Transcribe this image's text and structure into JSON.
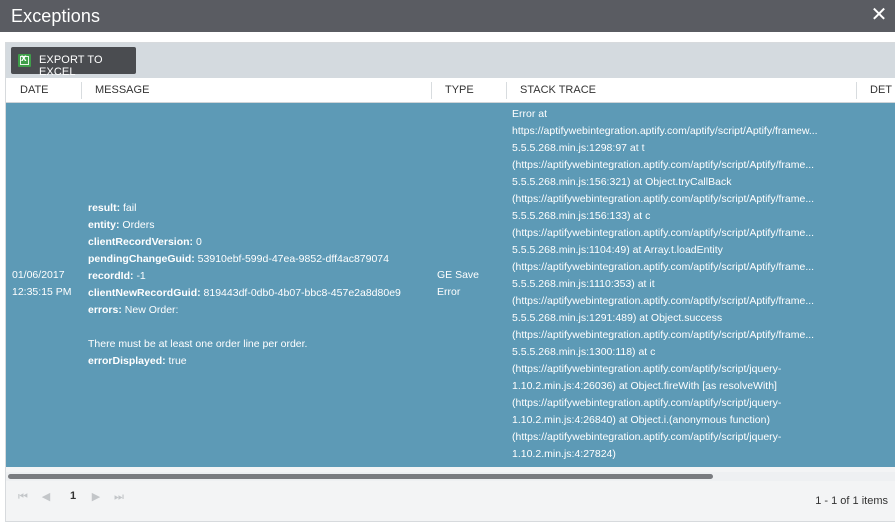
{
  "window": {
    "title": "Exceptions"
  },
  "toolbar": {
    "export_label": "EXPORT TO EXCEL"
  },
  "columns": {
    "date": "DATE",
    "message": "MESSAGE",
    "type": "TYPE",
    "stack": "STACK TRACE",
    "details": "DET"
  },
  "row": {
    "date": [
      "01/06/2017",
      "12:35:15 PM"
    ],
    "message": [
      {
        "k": "result:",
        "v": "fail"
      },
      {
        "k": "entity:",
        "v": "Orders"
      },
      {
        "k": "clientRecordVersion:",
        "v": "0"
      },
      {
        "k": "pendingChangeGuid:",
        "v": "53910ebf-599d-47ea-9852-dff4ac879074"
      },
      {
        "k": "recordId:",
        "v": "-1"
      },
      {
        "k": "clientNewRecordGuid:",
        "v": "819443df-0db0-4b07-bbc8-457e2a8d80e9"
      },
      {
        "k": "errors:",
        "v": "New Order:"
      },
      {
        "k": "",
        "v": ""
      },
      {
        "k": "",
        "v": "There must be at least one order line per order."
      },
      {
        "k": "errorDisplayed:",
        "v": "true"
      }
    ],
    "type": [
      "GE Save",
      "Error"
    ],
    "stack": [
      "Error at",
      "https://aptifywebintegration.aptify.com/aptify/script/Aptify/framew...",
      "5.5.5.268.min.js:1298:97 at t",
      "(https://aptifywebintegration.aptify.com/aptify/script/Aptify/frame...",
      "5.5.5.268.min.js:156:321) at Object.tryCallBack",
      "(https://aptifywebintegration.aptify.com/aptify/script/Aptify/frame...",
      "5.5.5.268.min.js:156:133) at c",
      "(https://aptifywebintegration.aptify.com/aptify/script/Aptify/frame...",
      "5.5.5.268.min.js:1104:49) at Array.t.loadEntity",
      "(https://aptifywebintegration.aptify.com/aptify/script/Aptify/frame...",
      "5.5.5.268.min.js:1110:353) at it",
      "(https://aptifywebintegration.aptify.com/aptify/script/Aptify/frame...",
      "5.5.5.268.min.js:1291:489) at Object.success",
      "(https://aptifywebintegration.aptify.com/aptify/script/Aptify/frame...",
      "5.5.5.268.min.js:1300:118) at c",
      "(https://aptifywebintegration.aptify.com/aptify/script/jquery-",
      "1.10.2.min.js:4:26036) at Object.fireWith [as resolveWith]",
      "(https://aptifywebintegration.aptify.com/aptify/script/jquery-",
      "1.10.2.min.js:4:26840) at Object.i.(anonymous function)",
      "(https://aptifywebintegration.aptify.com/aptify/script/jquery-",
      "1.10.2.min.js:4:27824)"
    ]
  },
  "pager": {
    "page": "1",
    "info": "1 - 1 of 1 items"
  }
}
